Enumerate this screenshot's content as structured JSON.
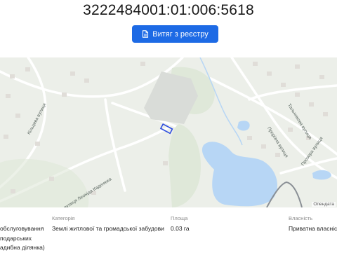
{
  "header": {
    "cadastral_number": "3222484001:01:006:5618",
    "extract_button_label": "Витяг з реєстру"
  },
  "map": {
    "streets": {
      "kiltseva": "Кільцева вулиця",
      "nazarko": "вулиця Леоніда Каденюка",
      "talnykova": "Тальникова вулиця",
      "prorizna": "Прорізна вулиця",
      "prozora": "Прозора вулиця"
    },
    "attribution": "Опендата",
    "colors": {
      "water": "#b7d6f5",
      "parcel": "#2d4de0",
      "background": "#ecefe9"
    }
  },
  "details": {
    "purpose_lines": [
      "обслуговування",
      "подарських",
      "адибна ділянка)"
    ],
    "category_label": "Категорія",
    "category_value": "Землі житлової та громадської забудови",
    "area_label": "Площа",
    "area_value": "0.03 га",
    "ownership_label": "Власність",
    "ownership_value": "Приватна власніс"
  }
}
